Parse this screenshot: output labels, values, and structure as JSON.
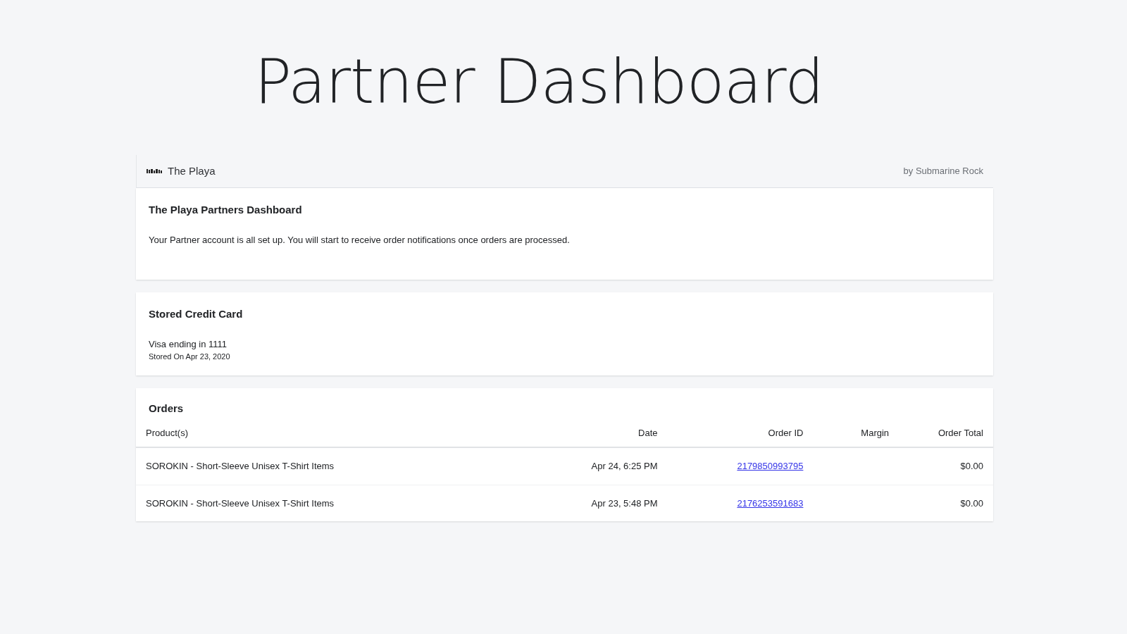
{
  "page_title": "Partner Dashboard",
  "header": {
    "store_name": "The Playa",
    "byline": "by Submarine Rock"
  },
  "welcome_card": {
    "title": "The Playa Partners Dashboard",
    "message": "Your Partner account is all set up. You will start to receive order notifications once orders are processed."
  },
  "credit_card": {
    "title": "Stored Credit Card",
    "card": "Visa ending in 1111",
    "stored_on": "Stored On Apr 23, 2020"
  },
  "orders": {
    "title": "Orders",
    "columns": [
      "Product(s)",
      "Date",
      "Order ID",
      "Margin",
      "Order Total"
    ],
    "rows": [
      {
        "product": "SOROKIN - Short-Sleeve Unisex T-Shirt Items",
        "date": "Apr 24, 6:25 PM",
        "order_id": "2179850993795",
        "total": "$0.00"
      },
      {
        "product": "SOROKIN - Short-Sleeve Unisex T-Shirt Items",
        "date": "Apr 23, 5:48 PM",
        "order_id": "2176253591683",
        "total": "$0.00"
      }
    ]
  }
}
